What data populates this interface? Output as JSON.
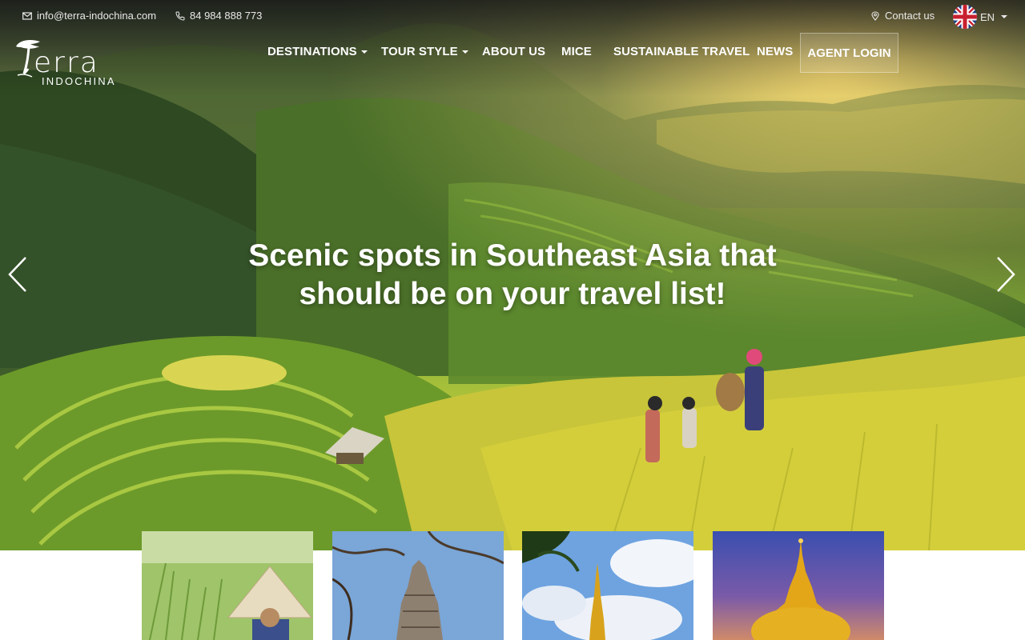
{
  "contact": {
    "email": "info@terra-indochina.com",
    "phone": "84 984 888 773",
    "contact_label": "Contact us",
    "language": "EN"
  },
  "brand": {
    "name": "erra",
    "tagline": "INDOCHINA"
  },
  "nav": {
    "items": [
      {
        "label": "DESTINATIONS",
        "dropdown": true
      },
      {
        "label": "TOUR STYLE",
        "dropdown": true
      },
      {
        "label": "ABOUT US",
        "dropdown": false
      },
      {
        "label": "MICE",
        "dropdown": false
      },
      {
        "label": "SUSTAINABLE TRAVEL",
        "dropdown": false
      },
      {
        "label": "NEWS",
        "dropdown": false
      }
    ],
    "agent_login": "AGENT LOGIN"
  },
  "hero": {
    "headline_line1": "Scenic spots in Southeast Asia that",
    "headline_line2": "should be on your travel list!",
    "prev_icon": "chevron-left-icon",
    "next_icon": "chevron-right-icon"
  },
  "cards": [
    {
      "subject": "rice-field-conical-hat"
    },
    {
      "subject": "khmer-temple-tower"
    },
    {
      "subject": "golden-stupa-clouds"
    },
    {
      "subject": "golden-rock-pagoda"
    }
  ],
  "colors": {
    "nav_text": "#ffffff",
    "topbar_text": "#e9e9e9",
    "accent_gold": "#d8a21c"
  }
}
